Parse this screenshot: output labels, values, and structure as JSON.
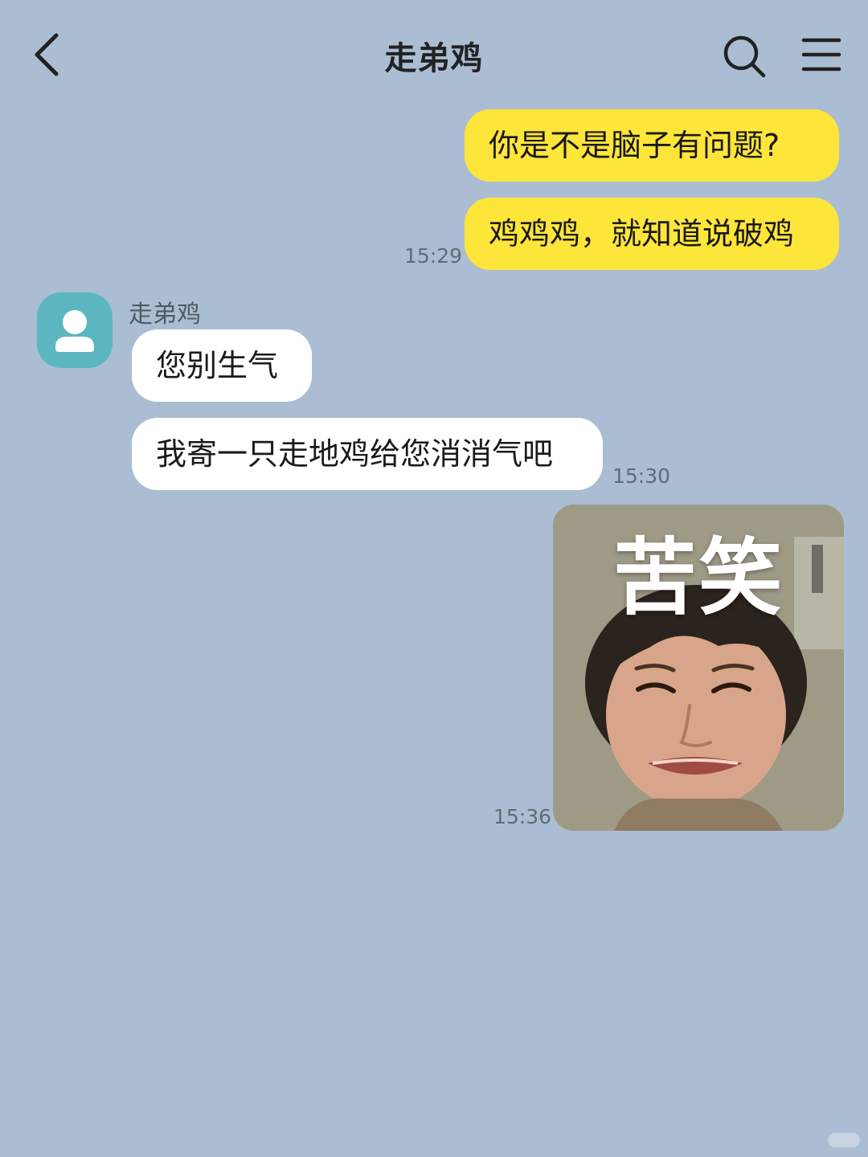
{
  "header": {
    "title": "走弟鸡",
    "back_icon": "chevron-left-icon",
    "search_icon": "search-icon",
    "menu_icon": "menu-icon"
  },
  "messages": [
    {
      "direction": "sent",
      "text": "你是不是脑子有问题?"
    },
    {
      "direction": "sent",
      "text": "鸡鸡鸡，就知道说破鸡",
      "time": "15:29"
    },
    {
      "direction": "received",
      "sender": "走弟鸡",
      "text": "您别生气"
    },
    {
      "direction": "received",
      "text": "我寄一只走地鸡给您消消气吧",
      "time": "15:30"
    },
    {
      "direction": "sent",
      "type": "sticker",
      "sticker_text": "苦笑",
      "time": "15:36"
    }
  ],
  "colors": {
    "background": "#abbdd3",
    "sent_bubble": "#fde53a",
    "received_bubble": "#ffffff",
    "avatar": "#5cb6bf"
  }
}
